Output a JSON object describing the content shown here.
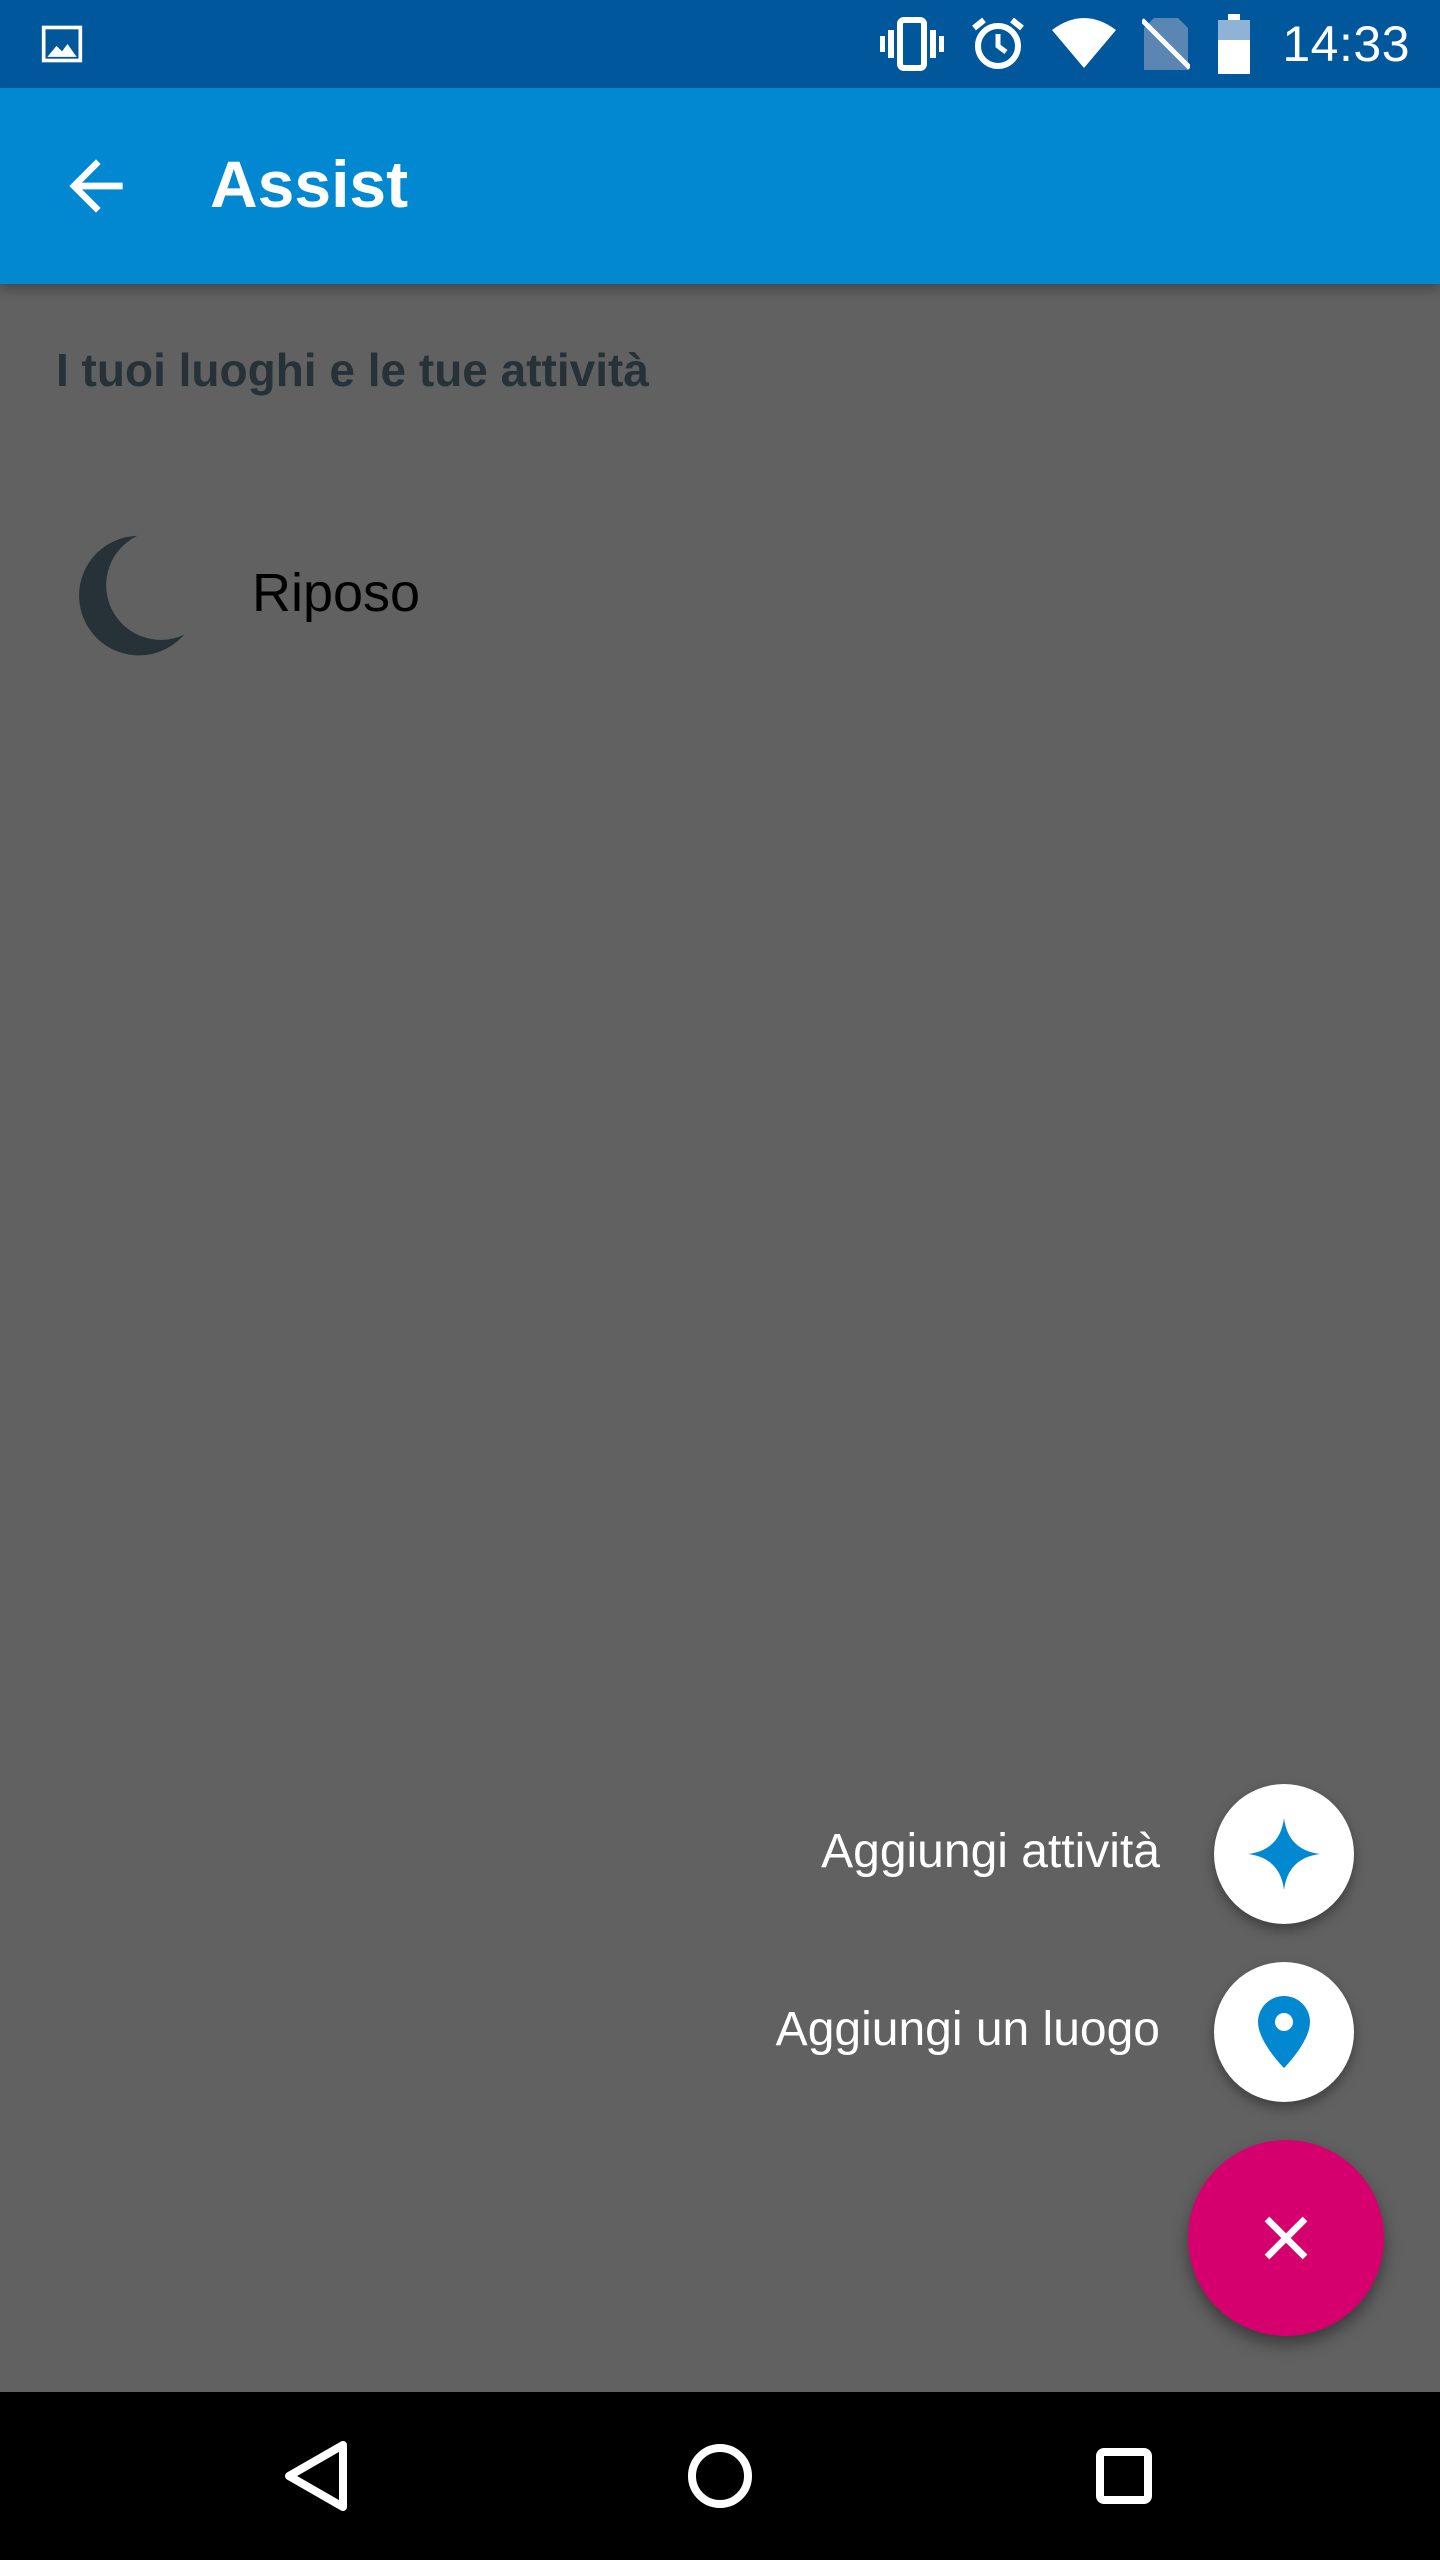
{
  "status_bar": {
    "time": "14:33",
    "icons": [
      "gallery-icon",
      "vibrate-icon",
      "alarm-icon",
      "wifi-icon",
      "no-sim-icon",
      "battery-icon"
    ]
  },
  "app_bar": {
    "title": "Assist",
    "back_icon": "arrow-back-icon"
  },
  "content": {
    "section_header": "I tuoi luoghi e le tue attività",
    "items": [
      {
        "label": "Riposo",
        "icon": "moon-icon"
      }
    ]
  },
  "fab_menu": {
    "actions": [
      {
        "label": "Aggiungi attività",
        "icon": "sparkle-icon"
      },
      {
        "label": "Aggiungi un luogo",
        "icon": "location-pin-icon"
      }
    ],
    "main_icon": "close-icon"
  },
  "colors": {
    "status_bar": "#01579b",
    "app_bar": "#0288d1",
    "scrim_background": "#616161",
    "accent": "#d5006d",
    "icon_blue": "#0288d1",
    "moon": "#263238"
  }
}
